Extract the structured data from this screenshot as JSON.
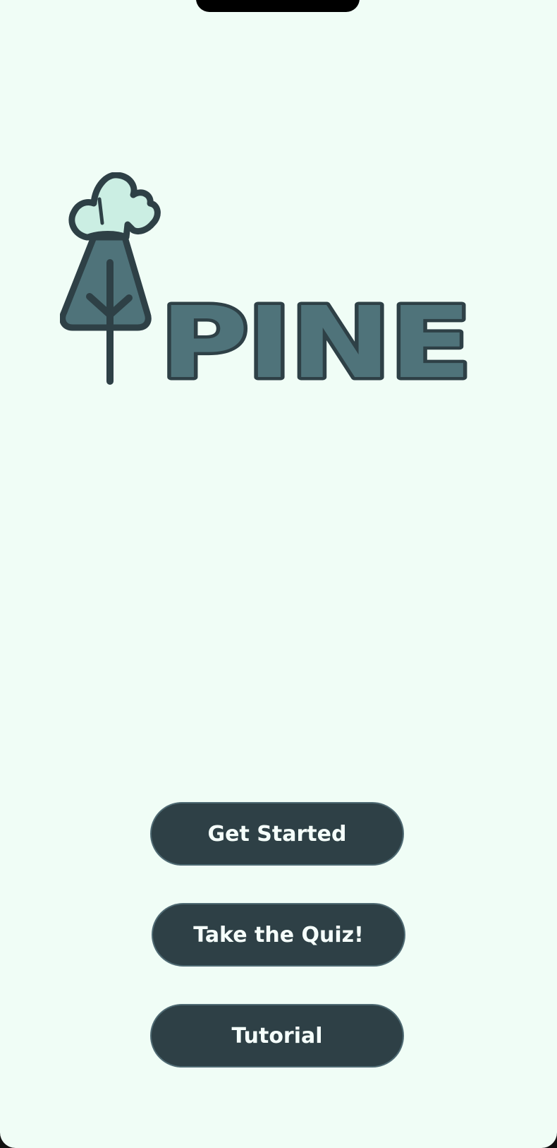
{
  "brand": {
    "wordmark": "PINE",
    "colors": {
      "background": "#f0fdf6",
      "logo_fill": "#4f737a",
      "logo_outline": "#2e4046",
      "cloud_fill": "#cbeee3",
      "button_bg": "#2e4046",
      "button_text": "#f5fffb"
    }
  },
  "icons": {
    "logo": "pine-tree-cloud-logo"
  },
  "actions": {
    "get_started": "Get Started",
    "take_quiz": "Take the Quiz!",
    "tutorial": "Tutorial"
  }
}
